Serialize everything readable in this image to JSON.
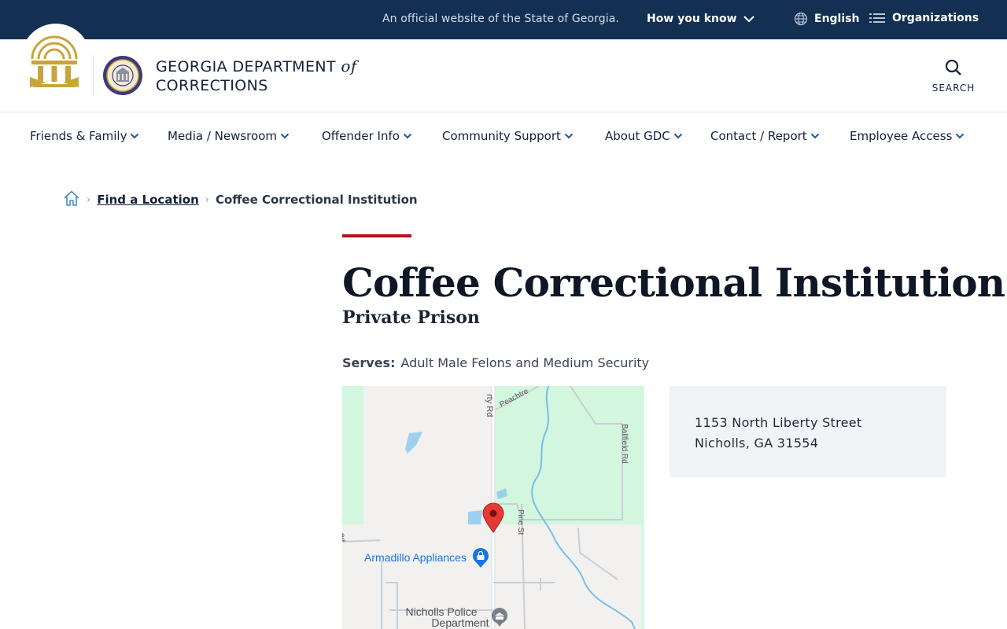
{
  "topbar": {
    "official_text": "An official website of the State of Georgia.",
    "how_you_know": "How you know",
    "language": "English",
    "organizations": "Organizations",
    "background_color": "#132f52"
  },
  "header": {
    "brand_line1": "GEORGIA DEPARTMENT",
    "brand_of": "of",
    "brand_line2": "CORRECTIONS",
    "search_label": "SEARCH"
  },
  "nav": {
    "items": [
      {
        "label": "Friends & Family"
      },
      {
        "label": "Media / Newsroom"
      },
      {
        "label": "Offender Info"
      },
      {
        "label": "Community Support"
      },
      {
        "label": "About GDC"
      },
      {
        "label": "Contact / Report"
      },
      {
        "label": "Employee Access"
      }
    ],
    "chevron_color": "#1c5a99"
  },
  "breadcrumb": {
    "home_icon": "home-icon",
    "link": "Find a Location",
    "current": "Coffee Correctional Institution"
  },
  "main": {
    "accent_color": "#b3121f",
    "title": "Coffee Correctional Institution",
    "subtitle": "Private Prison",
    "serves_label": "Serves:",
    "serves_value": "Adult Male Felons and Medium Security"
  },
  "map": {
    "labels": {
      "liberty_rd": "rty Rd",
      "peachtree": "Peachtre",
      "ballfield_rd": "Ballfield Rd",
      "pine_st": "Pine St",
      "armadillo": "Armadillo Appliances",
      "police_line1": "Nicholls Police",
      "police_line2": "Department",
      "left_edge": "ed"
    }
  },
  "address": {
    "line1": "1153 North Liberty Street",
    "line2": "Nicholls, GA 31554"
  }
}
